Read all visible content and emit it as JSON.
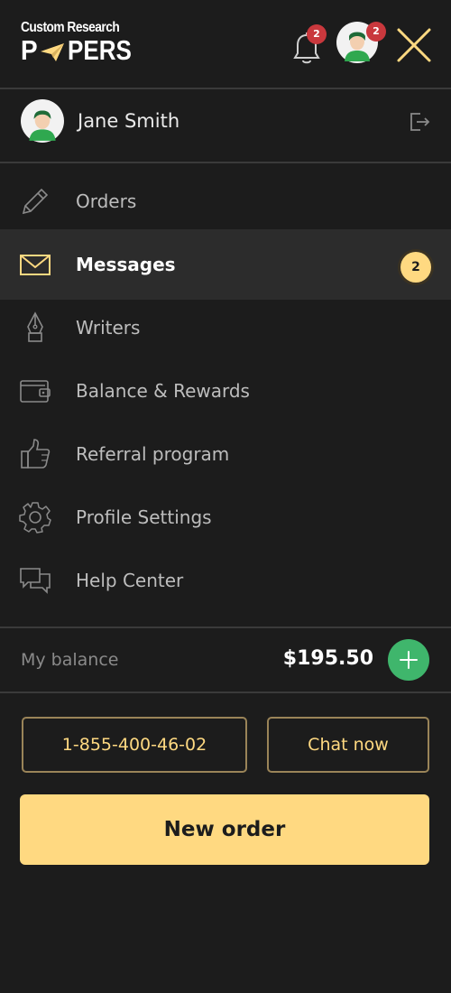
{
  "header": {
    "logo_top": "Custom Research",
    "logo_p": "P",
    "logo_rest": "PERS",
    "notification_count": "2",
    "avatar_badge_count": "2"
  },
  "user": {
    "name": "Jane Smith"
  },
  "nav": {
    "items": [
      {
        "label": "Orders",
        "icon": "pencil-icon"
      },
      {
        "label": "Messages",
        "icon": "envelope-icon",
        "badge": "2",
        "active": true
      },
      {
        "label": "Writers",
        "icon": "pen-nib-icon"
      },
      {
        "label": "Balance & Rewards",
        "icon": "wallet-icon"
      },
      {
        "label": "Referral program",
        "icon": "thumbs-up-icon"
      },
      {
        "label": "Profile Settings",
        "icon": "gear-icon"
      },
      {
        "label": "Help Center",
        "icon": "chat-bubbles-icon"
      }
    ]
  },
  "balance": {
    "label": "My balance",
    "value": "$195.50"
  },
  "actions": {
    "phone": "1-855-400-46-02",
    "chat": "Chat now",
    "new_order": "New order"
  },
  "colors": {
    "background": "#1c1c1c",
    "accent": "#ffd981",
    "badge_red": "#c9383d",
    "add_green": "#3fb66c",
    "active_row": "#2c2c2c"
  }
}
